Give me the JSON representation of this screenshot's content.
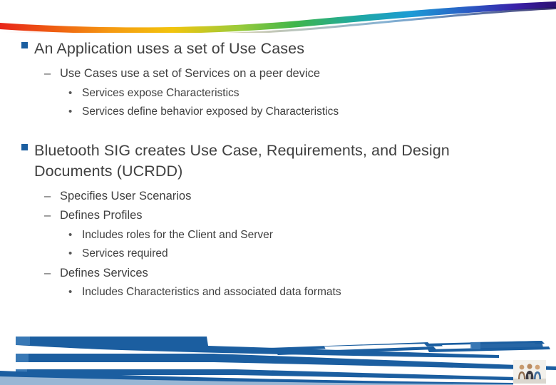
{
  "slide": {
    "accent_blue": "#1B5EA0",
    "text_color": "#404040",
    "background": "#FFFFFF",
    "markers": {
      "level1": "■",
      "level2": "–",
      "level3": "•"
    },
    "blocks": [
      {
        "level": 1,
        "text": "An Application uses a set of Use Cases"
      },
      {
        "level": 2,
        "text": "Use Cases use a set of Services on a peer device"
      },
      {
        "level": 3,
        "text": "Services expose Characteristics"
      },
      {
        "level": 3,
        "text": "Services define behavior exposed by Characteristics"
      },
      {
        "level": 1,
        "text": "Bluetooth SIG creates Use Case, Requirements, and Design Documents (UCRDD)"
      },
      {
        "level": 2,
        "text": "Specifies User Scenarios"
      },
      {
        "level": 2,
        "text": "Defines Profiles"
      },
      {
        "level": 3,
        "text": "Includes roles for the Client and Server"
      },
      {
        "level": 3,
        "text": "Services required"
      },
      {
        "level": 2,
        "text": "Defines Services"
      },
      {
        "level": 3,
        "text": "Includes Characteristics and associated data formats"
      }
    ]
  },
  "decor": {
    "rainbow_stops": [
      "#E8251A",
      "#EE5A12",
      "#F59A12",
      "#F2C40D",
      "#9ACB3B",
      "#3FB54A",
      "#1FA9A0",
      "#1C9BD6",
      "#2A5CC4",
      "#3A1FA8",
      "#2B1170"
    ],
    "footer_blue": "#1B5EA0",
    "footer_blue_light": "#3D7CB8",
    "photo_label": "three-people-photo"
  }
}
